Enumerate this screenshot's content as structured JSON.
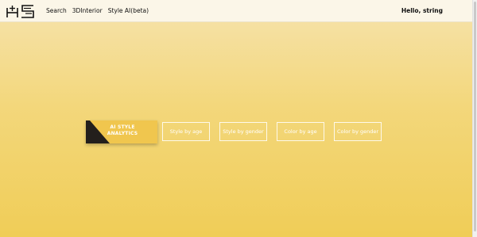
{
  "nav": {
    "logo": "logo-mark",
    "links": [
      "Search",
      "3DInterior",
      "Style AI(beta)"
    ],
    "greeting": "Hello, string"
  },
  "tabs": {
    "active": "AI STYLE ANALYTICS",
    "items": [
      "Style by age",
      "Style by gender",
      "Color by age",
      "Color by gender"
    ]
  },
  "colors": {
    "navbar_bg": "#fbf6e8",
    "page_gradient_top": "#f6e3ad",
    "page_gradient_bottom": "#f0cd57",
    "active_tab": "#f0c64e",
    "active_tab_accent": "#231f1c",
    "tab_border": "#ffffff"
  }
}
